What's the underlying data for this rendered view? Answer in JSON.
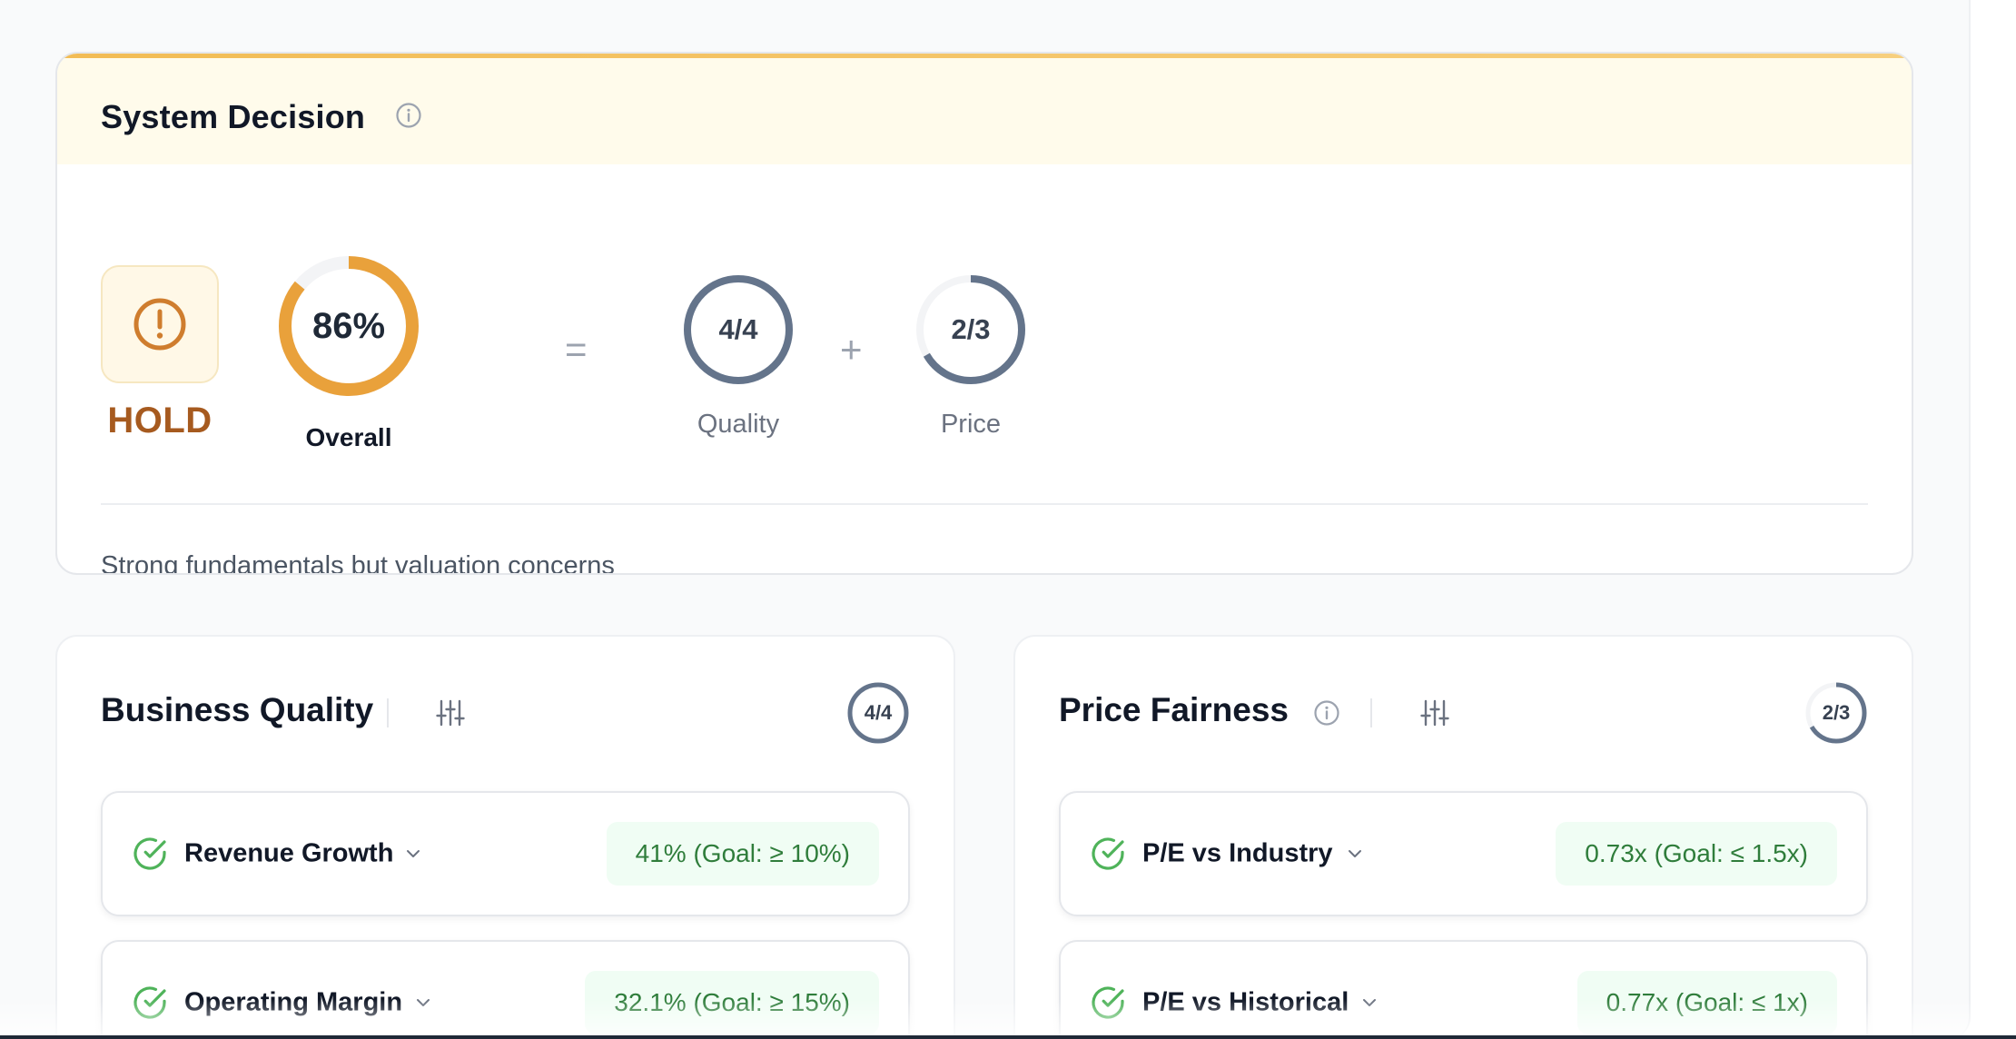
{
  "decision": {
    "title": "System Decision",
    "action": "HOLD",
    "overall": {
      "value": "86%",
      "caption": "Overall",
      "fraction": 0.86,
      "color": "#e9a13b"
    },
    "equals": "=",
    "plus": "+",
    "quality": {
      "value": "4/4",
      "caption": "Quality",
      "fraction": 1.0
    },
    "price": {
      "value": "2/3",
      "caption": "Price",
      "fraction": 0.6667
    },
    "summary": "Strong fundamentals but valuation concerns",
    "colors": {
      "accent": "#e9a13b",
      "hold": "#a65a1f",
      "ring": "#64748b"
    }
  },
  "business_quality": {
    "title": "Business Quality",
    "score": "4/4",
    "score_fraction": 1.0,
    "metrics": [
      {
        "label": "Revenue Growth",
        "result": "41% (Goal: ≥ 10%)",
        "status": "pass"
      },
      {
        "label": "Operating Margin",
        "result": "32.1% (Goal: ≥ 15%)",
        "status": "pass"
      }
    ]
  },
  "price_fairness": {
    "title": "Price Fairness",
    "score": "2/3",
    "score_fraction": 0.6667,
    "metrics": [
      {
        "label": "P/E vs Industry",
        "result": "0.73x (Goal: ≤ 1.5x)",
        "status": "pass"
      },
      {
        "label": "P/E vs Historical",
        "result": "0.77x (Goal: ≤ 1x)",
        "status": "pass"
      }
    ]
  },
  "icons": {
    "info": "info-icon",
    "alert": "alert-circle-icon",
    "settings": "sliders-icon",
    "check": "check-circle-icon",
    "expand": "chevron-down-icon"
  }
}
